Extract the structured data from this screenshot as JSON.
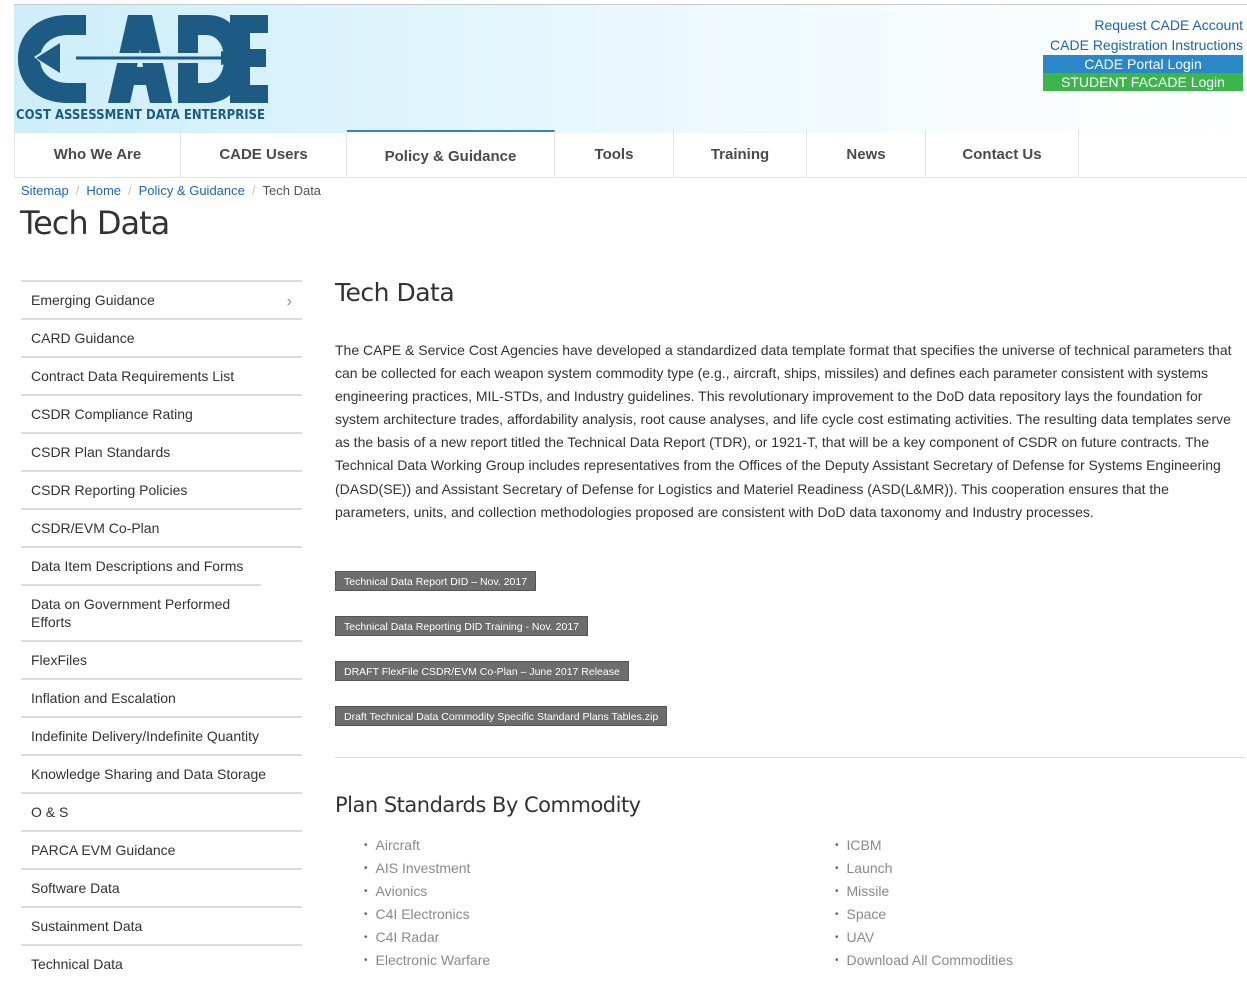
{
  "brand": {
    "logo_text": "CADE",
    "subtitle": "COST ASSESSMENT DATA ENTERPRISE",
    "colors": {
      "navy": "#1e5b84",
      "blue": "#2a87c8",
      "green": "#3cb54a"
    }
  },
  "header": {
    "request_account": "Request CADE Account",
    "registration": "CADE Registration Instructions",
    "portal_login": "CADE Portal Login",
    "student_login": "STUDENT FACADE Login"
  },
  "nav": {
    "items": [
      "Who We Are",
      "CADE Users",
      "Policy & Guidance",
      "Tools",
      "Training",
      "News",
      "Contact Us"
    ],
    "active": "Policy & Guidance"
  },
  "breadcrumb": [
    "Sitemap",
    "Home",
    "Policy & Guidance",
    "Tech Data"
  ],
  "page_title": "Tech Data",
  "sidebar": {
    "items": [
      "Emerging Guidance",
      "CARD Guidance",
      "Contract Data Requirements List",
      "CSDR Compliance Rating",
      "CSDR Plan Standards",
      "CSDR Reporting Policies",
      "CSDR/EVM Co-Plan",
      "Data Item Descriptions and Forms",
      "Data on Government Performed Efforts",
      "FlexFiles",
      "Inflation and Escalation",
      "Indefinite Delivery/Indefinite Quantity",
      "Knowledge Sharing and Data Storage",
      "O & S",
      "PARCA EVM Guidance",
      "Software Data",
      "Sustainment Data",
      "Technical Data"
    ],
    "expand_icon": "chevron-right-icon"
  },
  "content": {
    "title": "Tech Data",
    "intro": "The CAPE & Service Cost Agencies have developed a standardized data template format that specifies the universe of technical parameters that can be collected for each weapon system commodity type (e.g., aircraft, ships, missiles) and defines each parameter consistent with systems engineering practices, MIL-STDs, and Industry guidelines. This revolutionary improvement to the DoD data repository lays the foundation for system architecture trades, affordability analysis, root cause analyses, and life cycle cost estimating activities. The resulting data templates serve as the basis of a new report titled the Technical Data Report (TDR), or 1921-T, that will be a key component of CSDR on future contracts. The Technical Data Working Group includes representatives from the Offices of the Deputy Assistant Secretary of Defense for Systems Engineering (DASD(SE)) and Assistant Secretary of Defense for Logistics and Materiel Readiness (ASD(L&MR)). This cooperation ensures that the parameters, units, and collection methodologies proposed are consistent with DoD data taxonomy and Industry processes.",
    "documents": [
      "Technical Data Report DID – Nov. 2017",
      "Technical Data Reporting DID Training - Nov. 2017",
      "DRAFT FlexFile CSDR/EVM Co-Plan – June 2017 Release",
      "Draft Technical Data Commodity Specific Standard Plans Tables.zip"
    ],
    "plan_standards_title": "Plan Standards By Commodity",
    "commodities_left": [
      "Aircraft",
      "AIS Investment",
      "Avionics",
      "C4I Electronics",
      "C4I Radar",
      "Electronic Warfare"
    ],
    "commodities_right": [
      "ICBM",
      "Launch",
      "Missile",
      "Space",
      "UAV",
      "Download All Commodities"
    ]
  }
}
